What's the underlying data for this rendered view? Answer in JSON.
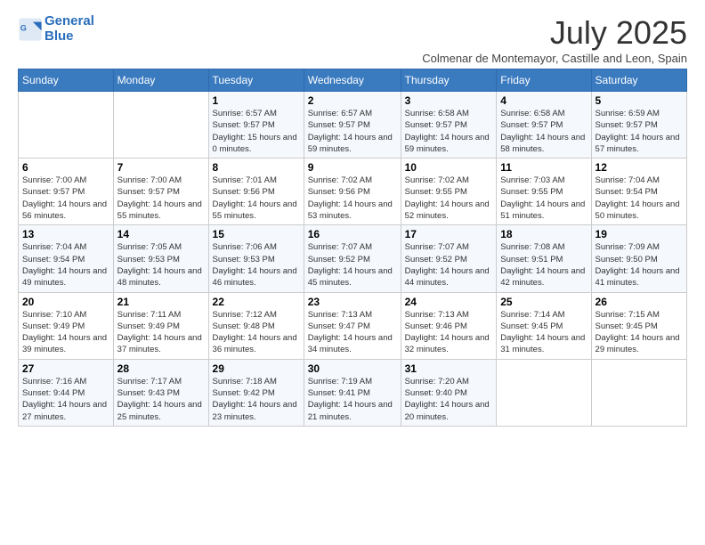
{
  "logo": {
    "line1": "General",
    "line2": "Blue"
  },
  "title": "July 2025",
  "subtitle": "Colmenar de Montemayor, Castille and Leon, Spain",
  "days_of_week": [
    "Sunday",
    "Monday",
    "Tuesday",
    "Wednesday",
    "Thursday",
    "Friday",
    "Saturday"
  ],
  "weeks": [
    [
      {
        "day": "",
        "sunrise": "",
        "sunset": "",
        "daylight": ""
      },
      {
        "day": "",
        "sunrise": "",
        "sunset": "",
        "daylight": ""
      },
      {
        "day": "1",
        "sunrise": "Sunrise: 6:57 AM",
        "sunset": "Sunset: 9:57 PM",
        "daylight": "Daylight: 15 hours and 0 minutes."
      },
      {
        "day": "2",
        "sunrise": "Sunrise: 6:57 AM",
        "sunset": "Sunset: 9:57 PM",
        "daylight": "Daylight: 14 hours and 59 minutes."
      },
      {
        "day": "3",
        "sunrise": "Sunrise: 6:58 AM",
        "sunset": "Sunset: 9:57 PM",
        "daylight": "Daylight: 14 hours and 59 minutes."
      },
      {
        "day": "4",
        "sunrise": "Sunrise: 6:58 AM",
        "sunset": "Sunset: 9:57 PM",
        "daylight": "Daylight: 14 hours and 58 minutes."
      },
      {
        "day": "5",
        "sunrise": "Sunrise: 6:59 AM",
        "sunset": "Sunset: 9:57 PM",
        "daylight": "Daylight: 14 hours and 57 minutes."
      }
    ],
    [
      {
        "day": "6",
        "sunrise": "Sunrise: 7:00 AM",
        "sunset": "Sunset: 9:57 PM",
        "daylight": "Daylight: 14 hours and 56 minutes."
      },
      {
        "day": "7",
        "sunrise": "Sunrise: 7:00 AM",
        "sunset": "Sunset: 9:57 PM",
        "daylight": "Daylight: 14 hours and 55 minutes."
      },
      {
        "day": "8",
        "sunrise": "Sunrise: 7:01 AM",
        "sunset": "Sunset: 9:56 PM",
        "daylight": "Daylight: 14 hours and 55 minutes."
      },
      {
        "day": "9",
        "sunrise": "Sunrise: 7:02 AM",
        "sunset": "Sunset: 9:56 PM",
        "daylight": "Daylight: 14 hours and 53 minutes."
      },
      {
        "day": "10",
        "sunrise": "Sunrise: 7:02 AM",
        "sunset": "Sunset: 9:55 PM",
        "daylight": "Daylight: 14 hours and 52 minutes."
      },
      {
        "day": "11",
        "sunrise": "Sunrise: 7:03 AM",
        "sunset": "Sunset: 9:55 PM",
        "daylight": "Daylight: 14 hours and 51 minutes."
      },
      {
        "day": "12",
        "sunrise": "Sunrise: 7:04 AM",
        "sunset": "Sunset: 9:54 PM",
        "daylight": "Daylight: 14 hours and 50 minutes."
      }
    ],
    [
      {
        "day": "13",
        "sunrise": "Sunrise: 7:04 AM",
        "sunset": "Sunset: 9:54 PM",
        "daylight": "Daylight: 14 hours and 49 minutes."
      },
      {
        "day": "14",
        "sunrise": "Sunrise: 7:05 AM",
        "sunset": "Sunset: 9:53 PM",
        "daylight": "Daylight: 14 hours and 48 minutes."
      },
      {
        "day": "15",
        "sunrise": "Sunrise: 7:06 AM",
        "sunset": "Sunset: 9:53 PM",
        "daylight": "Daylight: 14 hours and 46 minutes."
      },
      {
        "day": "16",
        "sunrise": "Sunrise: 7:07 AM",
        "sunset": "Sunset: 9:52 PM",
        "daylight": "Daylight: 14 hours and 45 minutes."
      },
      {
        "day": "17",
        "sunrise": "Sunrise: 7:07 AM",
        "sunset": "Sunset: 9:52 PM",
        "daylight": "Daylight: 14 hours and 44 minutes."
      },
      {
        "day": "18",
        "sunrise": "Sunrise: 7:08 AM",
        "sunset": "Sunset: 9:51 PM",
        "daylight": "Daylight: 14 hours and 42 minutes."
      },
      {
        "day": "19",
        "sunrise": "Sunrise: 7:09 AM",
        "sunset": "Sunset: 9:50 PM",
        "daylight": "Daylight: 14 hours and 41 minutes."
      }
    ],
    [
      {
        "day": "20",
        "sunrise": "Sunrise: 7:10 AM",
        "sunset": "Sunset: 9:49 PM",
        "daylight": "Daylight: 14 hours and 39 minutes."
      },
      {
        "day": "21",
        "sunrise": "Sunrise: 7:11 AM",
        "sunset": "Sunset: 9:49 PM",
        "daylight": "Daylight: 14 hours and 37 minutes."
      },
      {
        "day": "22",
        "sunrise": "Sunrise: 7:12 AM",
        "sunset": "Sunset: 9:48 PM",
        "daylight": "Daylight: 14 hours and 36 minutes."
      },
      {
        "day": "23",
        "sunrise": "Sunrise: 7:13 AM",
        "sunset": "Sunset: 9:47 PM",
        "daylight": "Daylight: 14 hours and 34 minutes."
      },
      {
        "day": "24",
        "sunrise": "Sunrise: 7:13 AM",
        "sunset": "Sunset: 9:46 PM",
        "daylight": "Daylight: 14 hours and 32 minutes."
      },
      {
        "day": "25",
        "sunrise": "Sunrise: 7:14 AM",
        "sunset": "Sunset: 9:45 PM",
        "daylight": "Daylight: 14 hours and 31 minutes."
      },
      {
        "day": "26",
        "sunrise": "Sunrise: 7:15 AM",
        "sunset": "Sunset: 9:45 PM",
        "daylight": "Daylight: 14 hours and 29 minutes."
      }
    ],
    [
      {
        "day": "27",
        "sunrise": "Sunrise: 7:16 AM",
        "sunset": "Sunset: 9:44 PM",
        "daylight": "Daylight: 14 hours and 27 minutes."
      },
      {
        "day": "28",
        "sunrise": "Sunrise: 7:17 AM",
        "sunset": "Sunset: 9:43 PM",
        "daylight": "Daylight: 14 hours and 25 minutes."
      },
      {
        "day": "29",
        "sunrise": "Sunrise: 7:18 AM",
        "sunset": "Sunset: 9:42 PM",
        "daylight": "Daylight: 14 hours and 23 minutes."
      },
      {
        "day": "30",
        "sunrise": "Sunrise: 7:19 AM",
        "sunset": "Sunset: 9:41 PM",
        "daylight": "Daylight: 14 hours and 21 minutes."
      },
      {
        "day": "31",
        "sunrise": "Sunrise: 7:20 AM",
        "sunset": "Sunset: 9:40 PM",
        "daylight": "Daylight: 14 hours and 20 minutes."
      },
      {
        "day": "",
        "sunrise": "",
        "sunset": "",
        "daylight": ""
      },
      {
        "day": "",
        "sunrise": "",
        "sunset": "",
        "daylight": ""
      }
    ]
  ]
}
